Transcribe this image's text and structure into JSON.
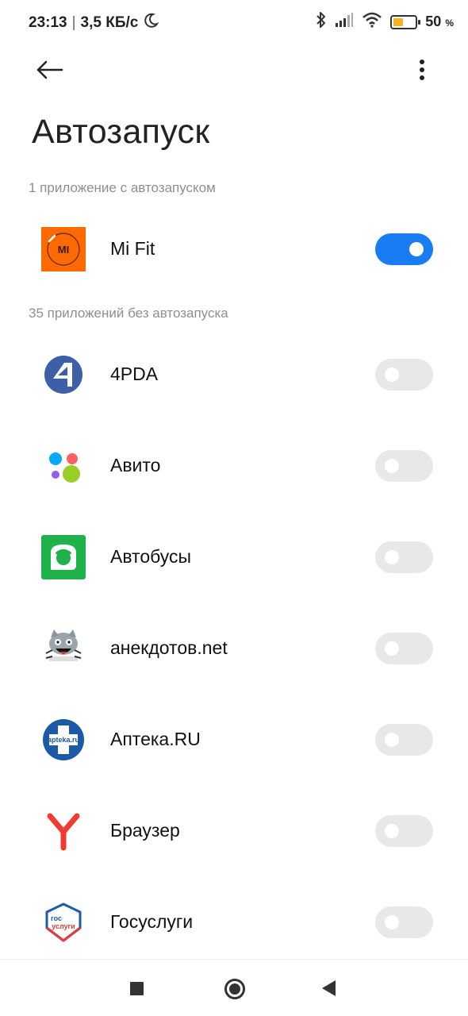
{
  "status_bar": {
    "time": "23:13",
    "separator": "|",
    "network_speed": "3,5 КБ/с",
    "battery_percent": "50",
    "battery_unit": "%",
    "icons": [
      "moon-icon",
      "bluetooth-icon",
      "signal-icon",
      "wifi-icon",
      "battery-icon"
    ],
    "battery_color": "#f0b322"
  },
  "header": {
    "back_icon": "arrow-left-icon",
    "more_icon": "more-vertical-icon",
    "title": "Автозапуск"
  },
  "sections": {
    "enabled_header": "1 приложение с автозапуском",
    "disabled_header": "35 приложений без автозапуска"
  },
  "apps_enabled": [
    {
      "name": "Mi Fit",
      "icon": "mi-fit-icon",
      "autostart": true
    }
  ],
  "apps_disabled": [
    {
      "name": "4PDA",
      "icon": "4pda-icon",
      "autostart": false
    },
    {
      "name": "Авито",
      "icon": "avito-icon",
      "autostart": false
    },
    {
      "name": "Автобусы",
      "icon": "buses-icon",
      "autostart": false
    },
    {
      "name": "анекдотов.net",
      "icon": "anekdotov-icon",
      "autostart": false
    },
    {
      "name": "Аптека.RU",
      "icon": "apteka-icon",
      "autostart": false
    },
    {
      "name": "Браузер",
      "icon": "yandex-browser-icon",
      "autostart": false
    },
    {
      "name": "Госуслуги",
      "icon": "gosuslugi-icon",
      "autostart": false
    }
  ],
  "icon_texts": {
    "apteka": "apteka.ru",
    "gos_line1": "гос",
    "gos_line2": "услуги"
  },
  "colors": {
    "toggle_on": "#1a7cf2",
    "toggle_off": "#e8e8e8",
    "mi_fit": "#ff6a00",
    "pda": "#3d5fa8",
    "buses": "#1fb24a",
    "apteka": "#1b5aa6",
    "yandex": "#f33a2e",
    "gosuslugi_blue": "#1c5ab4",
    "gosuslugi_red": "#e33a3a"
  },
  "nav_bar": {
    "icons": [
      "recents-square-icon",
      "home-circle-icon",
      "back-triangle-icon"
    ]
  }
}
